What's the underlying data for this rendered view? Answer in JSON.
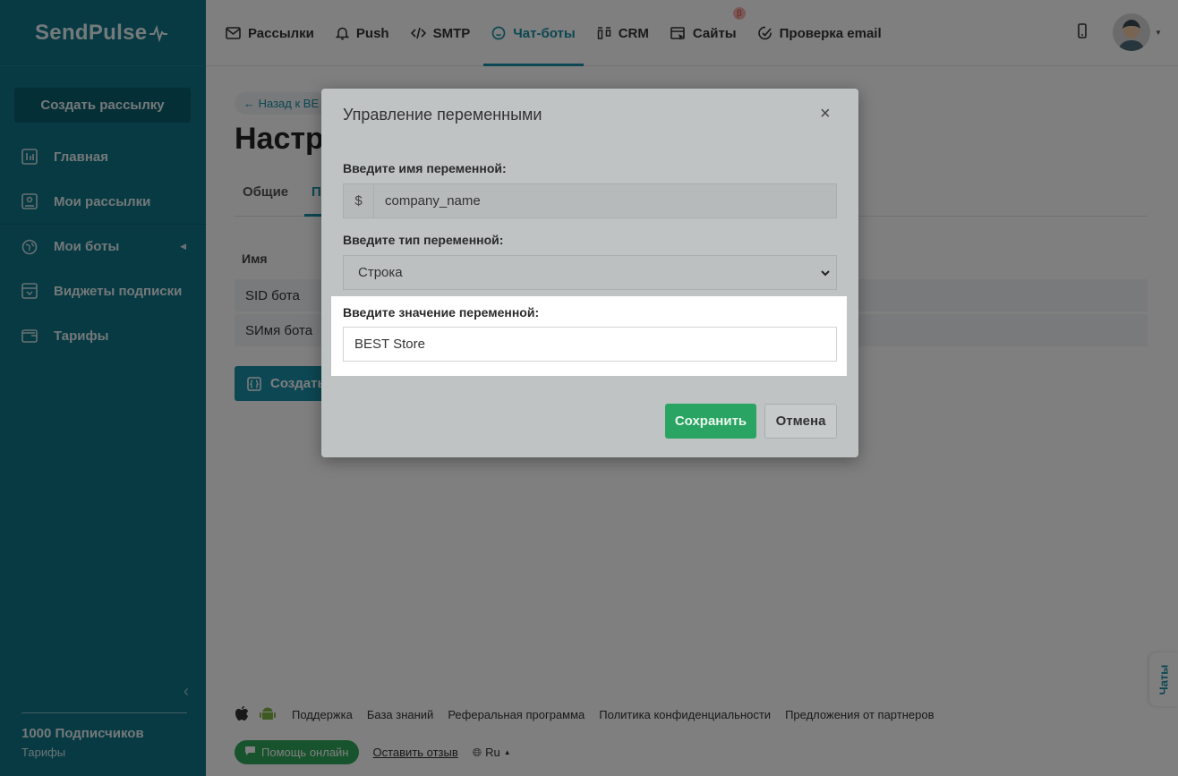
{
  "brand": {
    "name": "SendPulse"
  },
  "sidebar": {
    "create_button": "Создать рассылку",
    "items": [
      {
        "label": "Главная",
        "icon": "dashboard-icon"
      },
      {
        "label": "Мои рассылки",
        "icon": "mailings-icon"
      },
      {
        "label": "Мои боты",
        "icon": "globe-icon"
      },
      {
        "label": "Виджеты подписки",
        "icon": "widget-icon"
      },
      {
        "label": "Тарифы",
        "icon": "wallet-icon"
      }
    ],
    "subscribers": "1000 Подписчиков",
    "tariffs_link": "Тарифы"
  },
  "topnav": {
    "items": [
      {
        "label": "Рассылки",
        "icon": "envelope-icon"
      },
      {
        "label": "Push",
        "icon": "bell-icon"
      },
      {
        "label": "SMTP",
        "icon": "code-icon"
      },
      {
        "label": "Чат-боты",
        "icon": "chat-icon"
      },
      {
        "label": "CRM",
        "icon": "crm-icon"
      },
      {
        "label": "Сайты",
        "icon": "site-icon"
      },
      {
        "label": "Проверка email",
        "icon": "check-icon"
      }
    ],
    "active": "Чат-боты",
    "beta_badge": "β"
  },
  "page": {
    "back_link": "← Назад к BE",
    "title": "Настро",
    "tabs": [
      "Общие",
      "П"
    ],
    "table_header": "Имя",
    "rows": [
      "SID бота",
      "SИмя бота"
    ],
    "create_variable_button": "Создать"
  },
  "footer": {
    "links": [
      "Поддержка",
      "База знаний",
      "Реферальная программа",
      "Политика конфиденциальности",
      "Предложения от партнеров"
    ],
    "help_button": "Помощь онлайн",
    "feedback": "Оставить отзыв",
    "language": "Ru",
    "chats_tab": "Чаты"
  },
  "modal": {
    "title": "Управление переменными",
    "close": "×",
    "name_label": "Введите имя переменной:",
    "name_prefix": "$",
    "name_value": "company_name",
    "type_label": "Введите тип переменной:",
    "type_value": "Строка",
    "value_label": "Введите значение переменной:",
    "value_value": "BEST Store",
    "save_button": "Сохранить",
    "cancel_button": "Отмена"
  },
  "colors": {
    "sidebar": "#0e7487",
    "accent": "#1a8ea6",
    "save": "#2aa462"
  }
}
